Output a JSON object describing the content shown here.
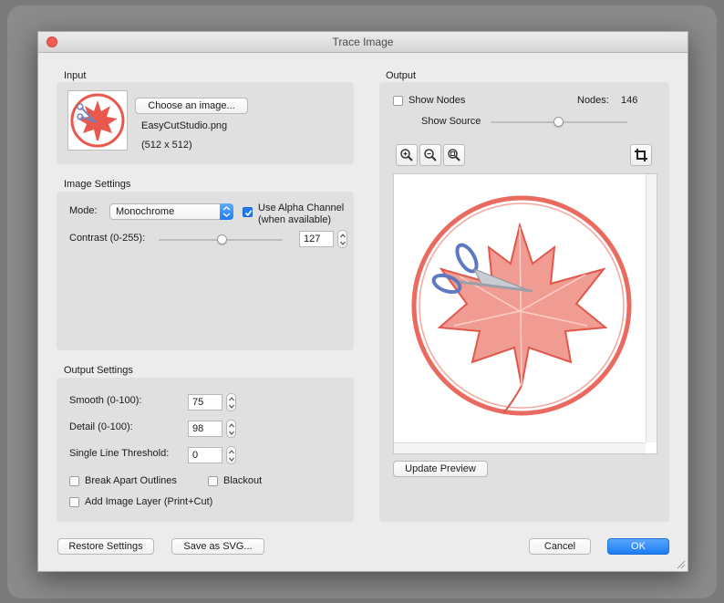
{
  "window": {
    "title": "Trace Image"
  },
  "input": {
    "section_label": "Input",
    "choose_button": "Choose an image...",
    "file_name": "EasyCutStudio.png",
    "dimensions": "(512 x 512)"
  },
  "image_settings": {
    "section_label": "Image Settings",
    "mode_label": "Mode:",
    "mode_value": "Monochrome",
    "alpha_label_line1": "Use Alpha Channel",
    "alpha_label_line2": "(when available)",
    "alpha_checked": true,
    "contrast_label": "Contrast (0-255):",
    "contrast_value": "127"
  },
  "output_settings": {
    "section_label": "Output Settings",
    "smooth_label": "Smooth (0-100):",
    "smooth_value": "75",
    "detail_label": "Detail (0-100):",
    "detail_value": "98",
    "threshold_label": "Single Line Threshold:",
    "threshold_value": "0",
    "break_apart_label": "Break Apart Outlines",
    "blackout_label": "Blackout",
    "add_layer_label": "Add Image Layer (Print+Cut)"
  },
  "output": {
    "section_label": "Output",
    "show_nodes_label": "Show Nodes",
    "nodes_label": "Nodes:",
    "nodes_value": "146",
    "show_source_label": "Show Source",
    "update_preview_button": "Update Preview"
  },
  "footer": {
    "restore_button": "Restore Settings",
    "save_svg_button": "Save as SVG...",
    "cancel_button": "Cancel",
    "ok_button": "OK"
  },
  "colors": {
    "accent": "#1f7cf3",
    "logo_red": "#e8584c",
    "close_red": "#f25c54"
  },
  "icons": [
    "zoom-in-icon",
    "zoom-out-icon",
    "zoom-fit-icon",
    "crop-icon",
    "scissors-icon",
    "maple-leaf-icon",
    "close-icon",
    "resize-grip-icon"
  ]
}
